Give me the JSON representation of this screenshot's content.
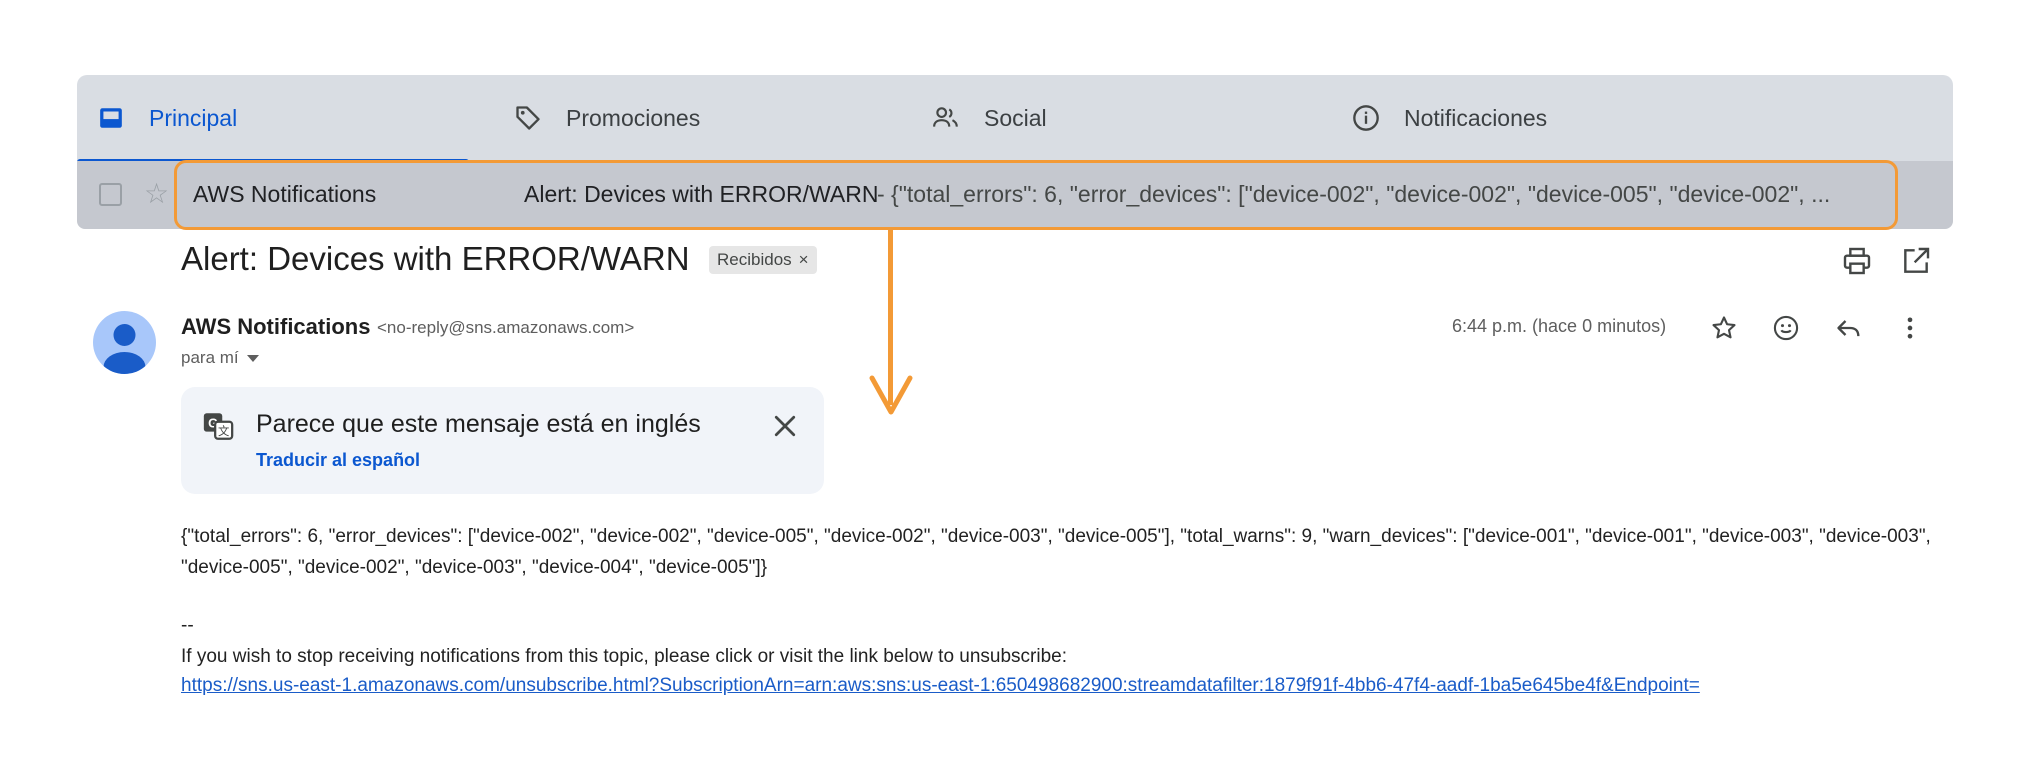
{
  "tabs": [
    {
      "label": "Principal",
      "icon": "inbox-icon",
      "active": true
    },
    {
      "label": "Promociones",
      "icon": "tag-icon"
    },
    {
      "label": "Social",
      "icon": "people-icon"
    },
    {
      "label": "Notificaciones",
      "icon": "info-icon"
    }
  ],
  "email_row": {
    "sender": "AWS Notifications",
    "subject": "Alert: Devices with ERROR/WARN",
    "snippet": "- {\"total_errors\": 6, \"error_devices\": [\"device-002\", \"device-002\", \"device-005\", \"device-002\", ..."
  },
  "message": {
    "subject": "Alert: Devices with ERROR/WARN",
    "label_chip": "Recibidos",
    "label_chip_close": "×",
    "sender_name": "AWS Notifications",
    "sender_email": "<no-reply@sns.amazonaws.com>",
    "recipient": "para mí",
    "timestamp": "6:44 p.m. (hace 0 minutos)"
  },
  "translate": {
    "text": "Parece que este mensaje está en inglés",
    "link": "Traducir al español"
  },
  "body": {
    "json_text": "{\"total_errors\": 6, \"error_devices\": [\"device-002\", \"device-002\", \"device-005\", \"device-002\", \"device-003\", \"device-005\"], \"total_warns\": 9, \"warn_devices\": [\"device-001\", \"device-001\", \"device-003\", \"device-003\", \"device-005\", \"device-002\", \"device-003\", \"device-004\", \"device-005\"]}",
    "separator": "--",
    "unsubscribe_text": "If you wish to stop receiving notifications from this topic, please click or visit the link below to unsubscribe:",
    "unsubscribe_link": "https://sns.us-east-1.amazonaws.com/unsubscribe.html?SubscriptionArn=arn:aws:sns:us-east-1:650498682900:streamdatafilter:1879f91f-4bb6-47f4-aadf-1ba5e645be4f&Endpoint="
  },
  "colors": {
    "accent": "#0b57d0",
    "highlight": "#f39a36",
    "tabs_background": "#d9dde3",
    "row_background": "#c5c8cf"
  }
}
